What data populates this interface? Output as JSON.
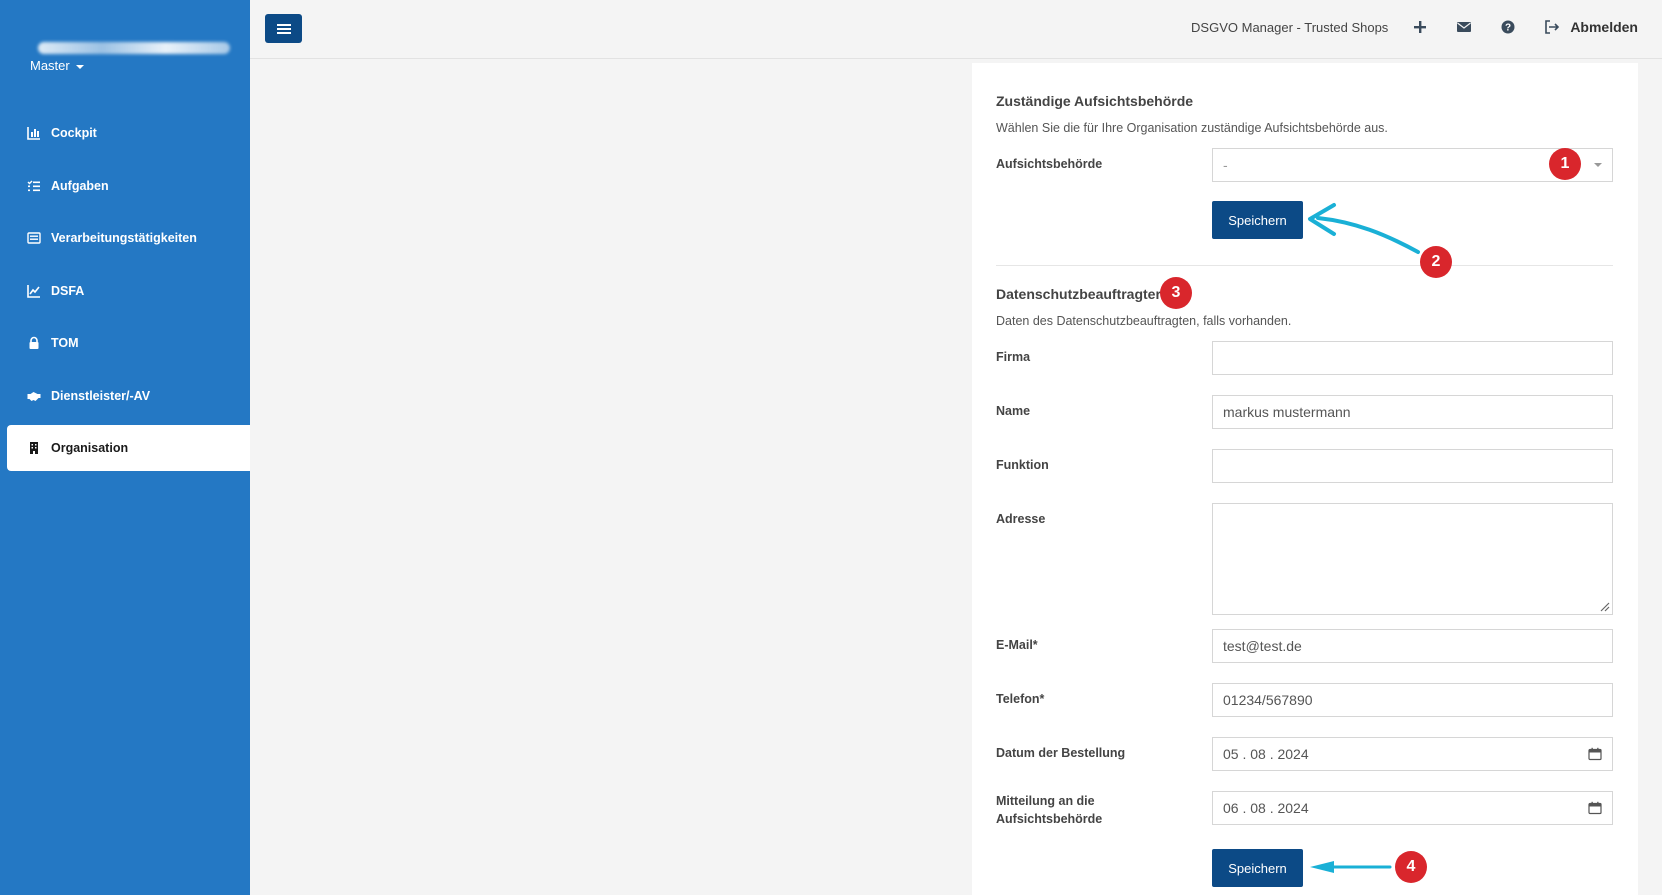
{
  "sidebar": {
    "account_selector": "Master",
    "items": [
      {
        "label": "Cockpit",
        "icon": "chart-bar-icon"
      },
      {
        "label": "Aufgaben",
        "icon": "tasks-icon"
      },
      {
        "label": "Verarbeitungstätigkeiten",
        "icon": "list-icon"
      },
      {
        "label": "DSFA",
        "icon": "line-chart-icon"
      },
      {
        "label": "TOM",
        "icon": "lock-icon"
      },
      {
        "label": "Dienstleister/-AV",
        "icon": "handshake-icon"
      },
      {
        "label": "Organisation",
        "icon": "building-icon",
        "active": true
      }
    ]
  },
  "topbar": {
    "app_title": "DSGVO Manager - Trusted Shops",
    "logout_label": "Abmelden"
  },
  "authority_section": {
    "title": "Zuständige Aufsichtsbehörde",
    "description": "Wählen Sie die für Ihre Organisation zuständige Aufsichtsbehörde aus.",
    "field_label": "Aufsichtsbehörde",
    "selected_value": "-",
    "save_label": "Speichern"
  },
  "dpo_section": {
    "title": "Datenschutzbeauftragter",
    "description": "Daten des Datenschutzbeauftragten, falls vorhanden.",
    "fields": {
      "firma": {
        "label": "Firma",
        "value": ""
      },
      "name": {
        "label": "Name",
        "value": "markus mustermann"
      },
      "funktion": {
        "label": "Funktion",
        "value": ""
      },
      "adresse": {
        "label": "Adresse",
        "value": ""
      },
      "email": {
        "label": "E-Mail*",
        "value": "test@test.de"
      },
      "telefon": {
        "label": "Telefon*",
        "value": "01234/567890"
      },
      "datum_bestellung": {
        "label": "Datum der Bestellung",
        "value": "05 . 08 . 2024"
      },
      "mitteilung": {
        "label": "Mitteilung an die Aufsichtsbehörde",
        "value": "06 . 08 . 2024"
      }
    },
    "save_label": "Speichern"
  },
  "annotations": {
    "badge_1": "1",
    "badge_2": "2",
    "badge_3": "3",
    "badge_4": "4",
    "badge_color": "#d9262c",
    "arrow_color": "#1ab0d6"
  },
  "colors": {
    "sidebar_bg": "#2478c4",
    "primary_button": "#0c4a86"
  }
}
